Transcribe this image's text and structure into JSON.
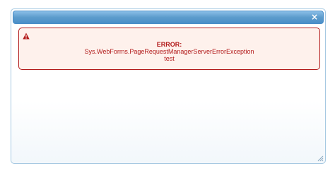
{
  "dialog": {
    "close_icon": "close-icon",
    "close_glyph": "×"
  },
  "error": {
    "icon": "warning-icon",
    "title": "ERROR:",
    "exception": "Sys.WebForms.PageRequestManagerServerErrorException",
    "message": "test",
    "color": "#b21a1a",
    "background": "#fef1ec"
  },
  "colors": {
    "titlebar": "#5c9ccc",
    "border": "#a6c9e2"
  }
}
